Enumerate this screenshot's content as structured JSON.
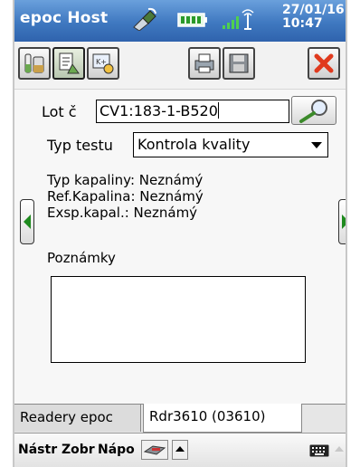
{
  "titlebar": {
    "app_title": "epoc Host",
    "date": "27/01/16",
    "time": "10:47"
  },
  "form": {
    "lot_label": "Lot č",
    "lot_value": "CV1:183-1-B520",
    "test_type_label": "Typ testu",
    "test_type_value": "Kontrola kvality",
    "fluid_type": "Typ kapaliny: Neznámý",
    "ref_fluid": "Ref.Kapalina: Neznámý",
    "exp_fluid": "Exsp.kapal.: Neznámý",
    "notes_label": "Poznámky",
    "notes_value": ""
  },
  "tabs": [
    {
      "label": "Readery epoc",
      "active": false
    },
    {
      "label": "Rdr3610 (03610)",
      "active": true
    }
  ],
  "menubar": {
    "items": [
      "Nástr",
      "Zobr",
      "Nápo"
    ]
  },
  "colors": {
    "titlebar": "#3f78c0",
    "nav_arrow": "#1e8a1e",
    "close_red": "#e03a1e"
  },
  "icons": [
    "sync-icon",
    "battery-icon",
    "signal-icon",
    "test-tube-icon",
    "document-icon",
    "qc-card-icon",
    "printer-icon",
    "save-icon",
    "close-icon",
    "search-icon",
    "left-arrow-icon",
    "right-arrow-icon",
    "card-reader-icon",
    "keyboard-icon"
  ]
}
